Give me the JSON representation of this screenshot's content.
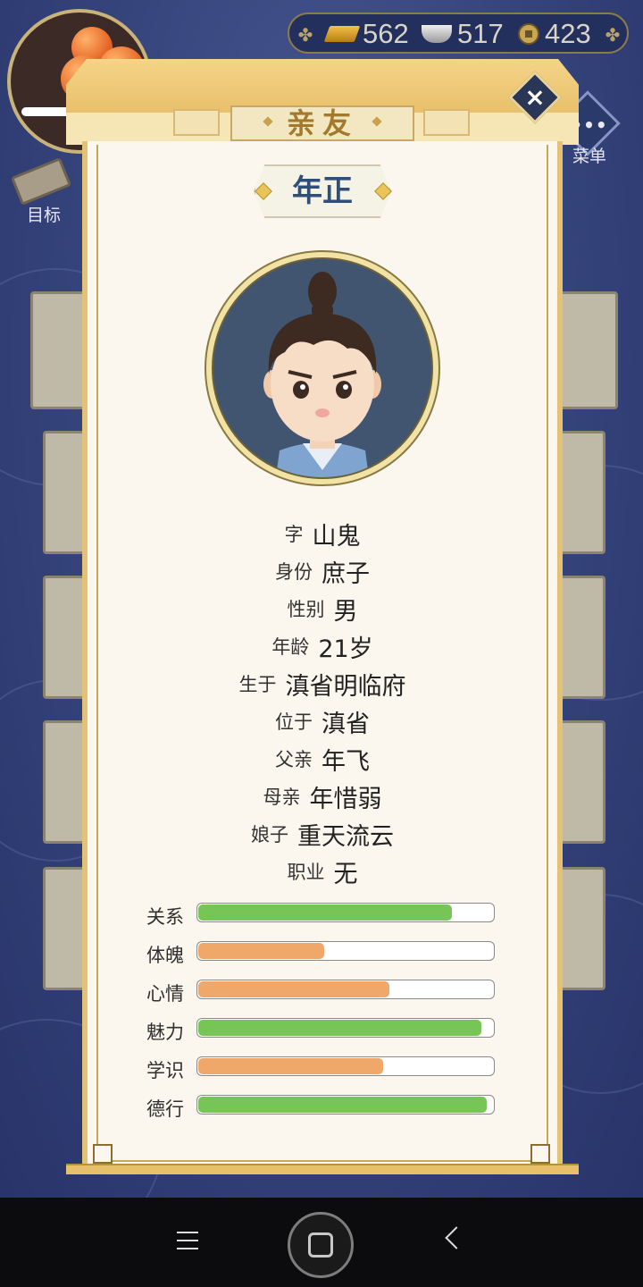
{
  "resources": {
    "gold": "562",
    "silver": "517",
    "coins": "423"
  },
  "hud": {
    "menu_dots": "•••",
    "menu_label": "菜单",
    "goal_label": "目标"
  },
  "dialog": {
    "title": "亲友",
    "close_icon": "×",
    "name": "年正",
    "info": [
      {
        "key": "字",
        "value": "山鬼"
      },
      {
        "key": "身份",
        "value": "庶子"
      },
      {
        "key": "性别",
        "value": "男"
      },
      {
        "key": "年龄",
        "value": "21岁"
      },
      {
        "key": "生于",
        "value": "滇省明临府"
      },
      {
        "key": "位于",
        "value": "滇省"
      },
      {
        "key": "父亲",
        "value": "年飞"
      },
      {
        "key": "母亲",
        "value": "年惜弱"
      },
      {
        "key": "娘子",
        "value": "重天流云"
      },
      {
        "key": "职业",
        "value": "无"
      }
    ],
    "stats": [
      {
        "label": "关系",
        "level": 0.86,
        "color": "#77c556"
      },
      {
        "label": "体魄",
        "level": 0.43,
        "color": "#f0a86a"
      },
      {
        "label": "心情",
        "level": 0.65,
        "color": "#f0a86a"
      },
      {
        "label": "魅力",
        "level": 0.96,
        "color": "#77c556"
      },
      {
        "label": "学识",
        "level": 0.63,
        "color": "#f0a86a"
      },
      {
        "label": "德行",
        "level": 0.98,
        "color": "#77c556"
      }
    ]
  },
  "colors": {
    "accent_green": "#77c556",
    "accent_orange": "#f0a86a",
    "name_blue": "#2f4f79"
  }
}
